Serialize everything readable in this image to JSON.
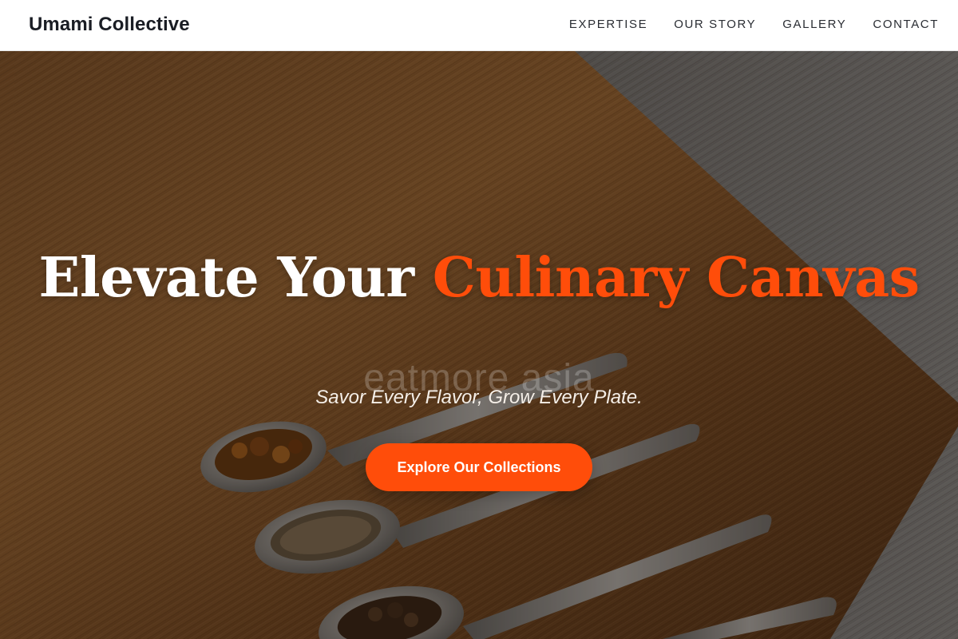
{
  "header": {
    "brand": "Umami Collective",
    "nav": [
      {
        "label": "EXPERTISE"
      },
      {
        "label": "OUR STORY"
      },
      {
        "label": "GALLERY"
      },
      {
        "label": "CONTACT"
      }
    ]
  },
  "hero": {
    "title_part1": "Elevate Your ",
    "title_accent": "Culinary Canvas",
    "watermark": "eatmore asia",
    "tagline": "Savor Every Flavor, Grow Every Plate.",
    "cta_label": "Explore Our Collections"
  },
  "colors": {
    "accent": "#ff4d0a",
    "header_bg": "#ffffff",
    "text_dark": "#1a1d24"
  },
  "icons": {
    "hero_image": "spice-spoons-photo"
  }
}
